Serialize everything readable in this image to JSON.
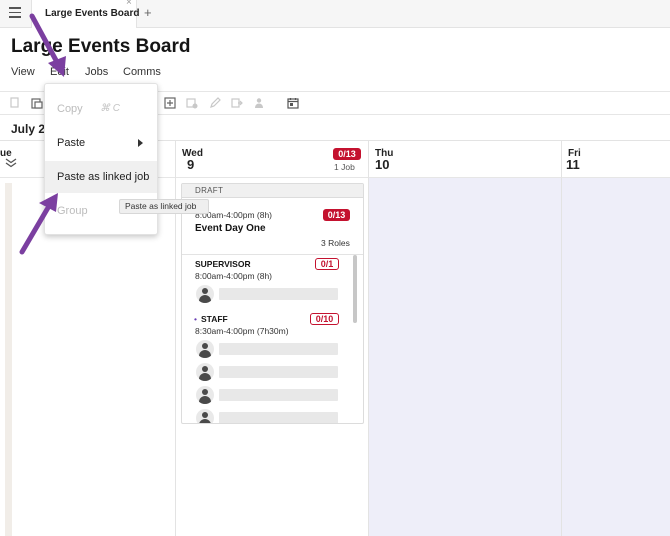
{
  "tabbar": {
    "menu_icon": "hamburger-icon",
    "tab_label": "Large Events Board",
    "close_glyph": "×",
    "add_glyph": "+"
  },
  "board_title": "Large Events Board",
  "menubar": [
    "View",
    "Edit",
    "Jobs",
    "Comms"
  ],
  "toolbar_icons": [
    "copy-icon",
    "paste-icon",
    "add-job-icon",
    "add-shift-icon",
    "pencil-icon",
    "forward-icon",
    "assign-staff-icon",
    "calendar-icon"
  ],
  "date_label": "July 2",
  "columns": {
    "partial_day_label": "ue",
    "wed": {
      "day": "Wed",
      "num": "9",
      "badge": "0/13",
      "count": "1 Job"
    },
    "thu": {
      "day": "Thu",
      "num": "10"
    },
    "fri": {
      "day": "Fri",
      "num": "11"
    }
  },
  "card": {
    "status": "DRAFT",
    "time": "8:00am-4:00pm (8h)",
    "badge": "0/13",
    "name": "Event Day One",
    "roles": "3 Roles",
    "role1": {
      "name": "SUPERVISOR",
      "badge": "0/1",
      "time": "8:00am-4:00pm (8h)"
    },
    "role2": {
      "bullet": "•",
      "name": "STAFF",
      "badge": "0/10",
      "time": "8:30am-4:00pm (7h30m)"
    }
  },
  "menu": {
    "copy": "Copy",
    "copy_shortcut": "⌘ C",
    "paste": "Paste",
    "paste_linked": "Paste as linked job",
    "group": "Group"
  },
  "tooltip": "Paste as linked job",
  "colors": {
    "badge_red": "#c4122f",
    "annotation_arrow": "#7b3fa0",
    "shaded_column": "#eeeef9"
  }
}
